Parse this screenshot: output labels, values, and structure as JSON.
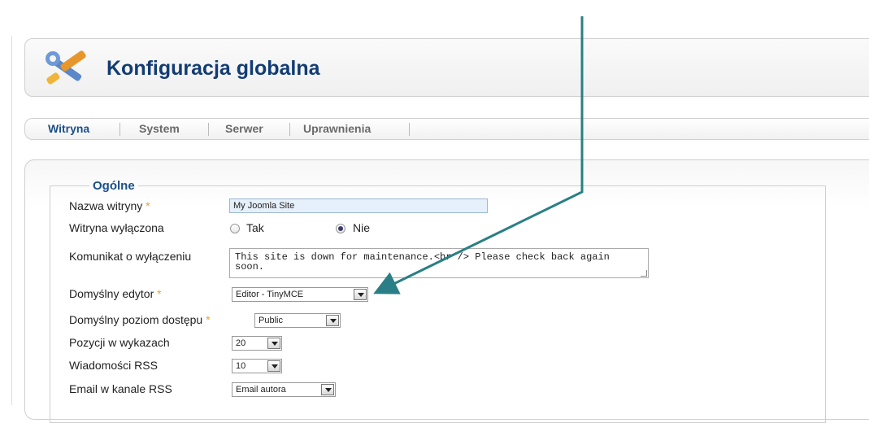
{
  "header": {
    "title": "Konfiguracja globalna"
  },
  "tabs": [
    {
      "label": "Witryna",
      "active": true
    },
    {
      "label": "System",
      "active": false
    },
    {
      "label": "Serwer",
      "active": false
    },
    {
      "label": "Uprawnienia",
      "active": false
    }
  ],
  "section": {
    "legend": "Ogólne"
  },
  "fields": {
    "site_name": {
      "label": "Nazwa witryny",
      "required_mark": "*",
      "value": "My Joomla Site"
    },
    "offline": {
      "label": "Witryna wyłączona",
      "options": [
        "Tak",
        "Nie"
      ],
      "selected": "Nie"
    },
    "offline_message": {
      "label": "Komunikat o wyłączeniu",
      "value": "This site is down for maintenance.<br /> Please check back again soon."
    },
    "default_editor": {
      "label": "Domyślny edytor",
      "required_mark": "*",
      "value": "Editor - TinyMCE"
    },
    "default_access": {
      "label": "Domyślny poziom dostępu",
      "required_mark": "*",
      "value": "Public"
    },
    "list_limit": {
      "label": "Pozycji w wykazach",
      "value": "20"
    },
    "rss_items": {
      "label": "Wiadomości RSS",
      "value": "10"
    },
    "rss_email": {
      "label": "Email w kanale RSS",
      "value": "Email autora"
    }
  },
  "colors": {
    "title": "#123c74",
    "tab_active": "#1b4f88",
    "required": "#f4a11d",
    "arrow": "#2a7f86"
  },
  "icons": [
    "tools-icon",
    "dropdown-arrow-icon"
  ]
}
